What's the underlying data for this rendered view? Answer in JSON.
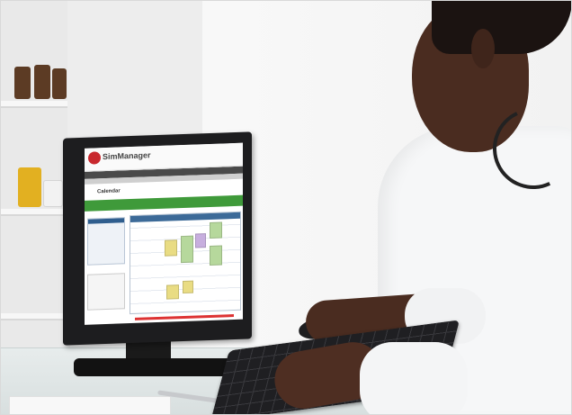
{
  "screen_app": {
    "logo_text": "SimManager",
    "page_title": "Calendar"
  },
  "colors": {
    "success_green": "#3f9a3a",
    "calendar_blue": "#3c6a98",
    "logo_red": "#c8282e"
  }
}
